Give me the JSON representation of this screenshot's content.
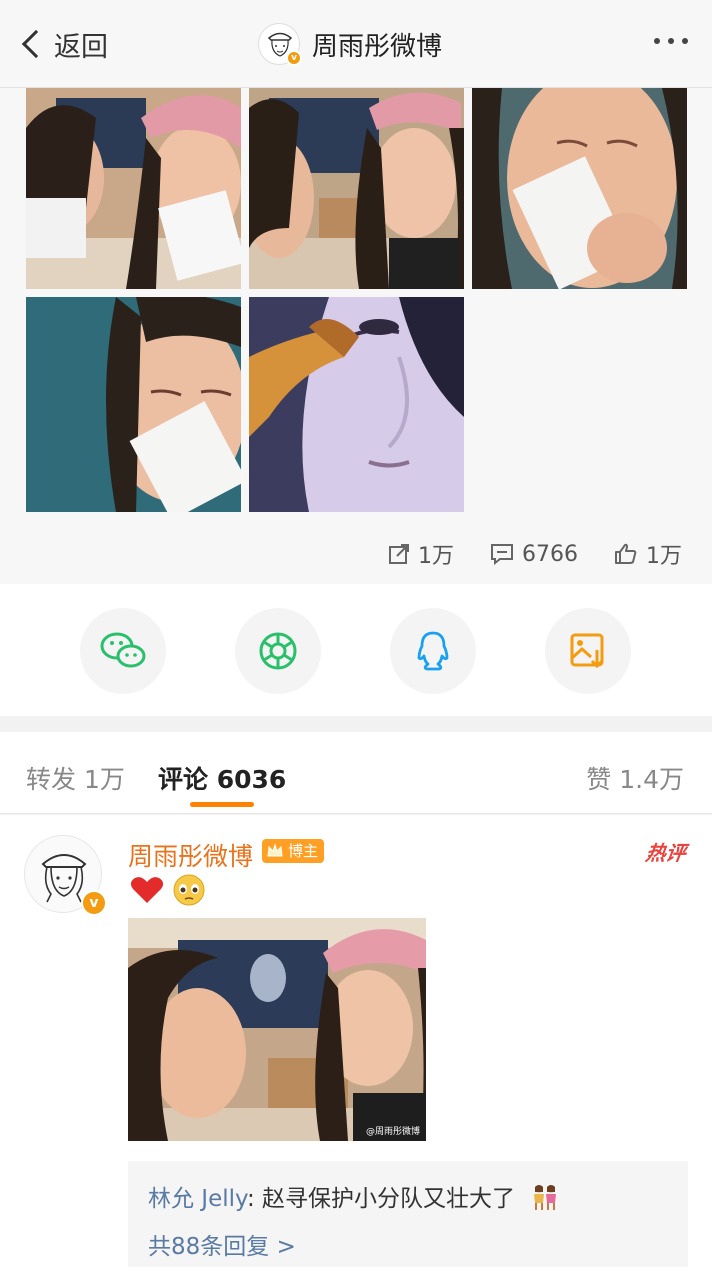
{
  "header": {
    "back_label": "返回",
    "title": "周雨彤微博",
    "more_icon": "more-dots-icon"
  },
  "post": {
    "photo_count": 5,
    "stats": {
      "reposts": "1万",
      "comments": "6766",
      "likes": "1万"
    }
  },
  "share": {
    "items": [
      {
        "name": "wechat",
        "icon": "wechat-icon"
      },
      {
        "name": "moments",
        "icon": "moments-icon"
      },
      {
        "name": "qq",
        "icon": "qq-icon"
      },
      {
        "name": "save-image",
        "icon": "save-image-icon"
      }
    ]
  },
  "tabs": {
    "repost": "转发 1万",
    "comment": "评论 6036",
    "like": "赞 1.4万",
    "active": "comment"
  },
  "comment": {
    "author": "周雨彤微博",
    "host_badge": "博主",
    "hot_badge": "热评",
    "emojis": [
      "heart",
      "pleading-face"
    ],
    "watermark": "@周雨彤微博",
    "reply_user": "林允 Jelly",
    "reply_text": ": 赵寻保护小分队又壮大了",
    "reply_more": "共88条回复 >"
  },
  "colors": {
    "accent": "#ff8200",
    "link": "#5a7aa6",
    "name": "#e8731d",
    "hot": "#e8433d"
  }
}
